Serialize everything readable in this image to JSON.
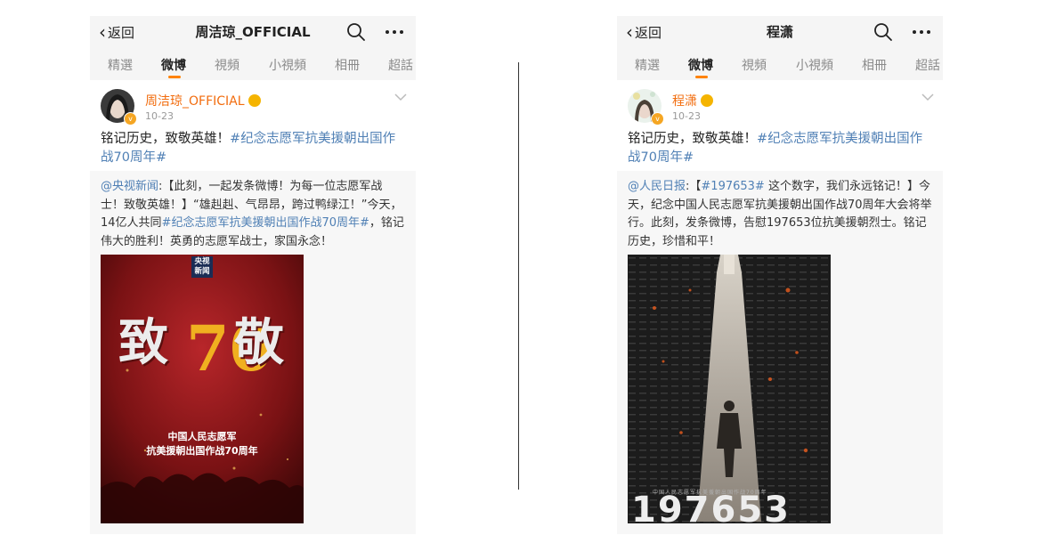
{
  "left": {
    "back_label": "返回",
    "title": "周洁琼_OFFICIAL",
    "tabs": [
      "精選",
      "微博",
      "視頻",
      "小視頻",
      "相冊",
      "超話"
    ],
    "active_tab": "微博",
    "post": {
      "username": "周洁琼_OFFICIAL",
      "date": "10-23",
      "text_plain": "铭记历史，致敬英雄！",
      "text_hashtag": "#纪念志愿军抗美援朝出国作战70周年#",
      "repost": {
        "mention": "@央视新闻",
        "part1": ":【此刻，一起发条微博！为每一位志愿军战士！致敬英雄！】“雄赳赳、气昂昂，跨过鸭绿江！”今天，14亿人共同",
        "hashtag": "#纪念志愿军抗美援朝出国作战70周年#",
        "part2": "，铭记伟大的胜利！英勇的志愿军战士，家国永念！"
      },
      "poster": {
        "tag_line1": "央视",
        "tag_line2": "新闻",
        "big_text_left": "致",
        "big_text_num": "70",
        "big_text_right": "敬",
        "subtitle1": "中国人民志愿军",
        "subtitle2": "抗美援朝出国作战70周年"
      }
    }
  },
  "right": {
    "back_label": "返回",
    "title": "程潇",
    "tabs": [
      "精選",
      "微博",
      "視頻",
      "小視頻",
      "相冊",
      "超話"
    ],
    "active_tab": "微博",
    "post": {
      "username": "程潇",
      "date": "10-23",
      "text_plain": "铭记历史，致敬英雄！",
      "text_hashtag": "#纪念志愿军抗美援朝出国作战70周年#",
      "repost": {
        "mention": "@人民日报",
        "part1": ":【",
        "hashtag": "#197653#",
        "part2": " 这个数字，我们永远铭记！】今天，纪念中国人民志愿军抗美援朝出国作战70周年大会将举行。此刻，发条微博，告慰197653位抗美援朝烈士。铭记历史，珍惜和平！"
      },
      "poster": {
        "caption": "中国人民志愿军抗美援朝出国作战70周年",
        "big_number": "197653"
      }
    }
  },
  "colors": {
    "username": "#f26d0f",
    "link": "#5080b5",
    "tab_indicator": "#ff8200",
    "verified_badge": "#f5a623"
  },
  "icons": [
    "chevron-left-icon",
    "search-icon",
    "more-icon",
    "dropdown-caret-icon",
    "verified-badge-icon",
    "crown-icon"
  ]
}
